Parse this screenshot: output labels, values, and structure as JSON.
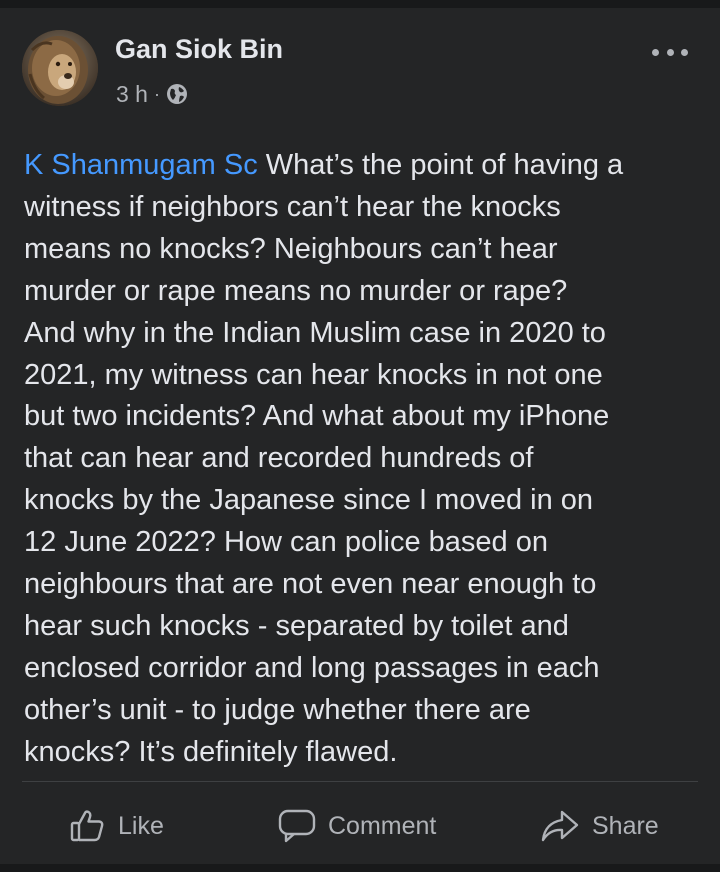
{
  "post": {
    "author": "Gan Siok Bin",
    "time": "3 h",
    "separator": "·",
    "privacy_icon": "globe-icon",
    "mention": "K Shanmugam Sc",
    "body": " What’s the point of having a\nwitness if neighbors can’t hear the knocks\nmeans no knocks? Neighbours can’t hear\nmurder or rape means no murder or rape?\nAnd why in the Indian Muslim case in 2020 to\n2021, my witness can hear knocks in not one\nbut two incidents? And what about my iPhone\nthat can hear and recorded hundreds of\nknocks by the Japanese since I moved in on\n12 June 2022? How can police based on\nneighbours that are not even near enough to\nhear such knocks - separated by toilet and\nenclosed corridor and long passages in each\nother’s unit - to judge whether there are\nknocks? It’s definitely flawed."
  },
  "actions": {
    "like": "Like",
    "comment": "Comment",
    "share": "Share"
  },
  "colors": {
    "background": "#18191a",
    "card": "#242526",
    "text": "#e4e6eb",
    "secondary": "#b0b3b8",
    "mention": "#4599ff"
  }
}
